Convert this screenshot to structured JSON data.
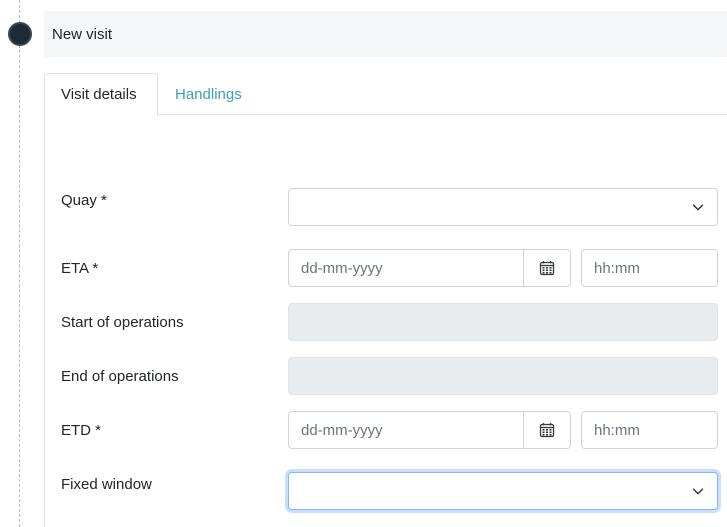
{
  "header": {
    "title": "New visit"
  },
  "tabs": [
    {
      "label": "Visit details",
      "active": true
    },
    {
      "label": "Handlings",
      "active": false
    }
  ],
  "form": {
    "quay": {
      "label": "Quay *",
      "value": ""
    },
    "eta": {
      "label": "ETA *",
      "date_placeholder": "dd-mm-yyyy",
      "time_placeholder": "hh:mm"
    },
    "start_ops": {
      "label": "Start of operations",
      "value": ""
    },
    "end_ops": {
      "label": "End of operations",
      "value": ""
    },
    "etd": {
      "label": "ETD *",
      "date_placeholder": "dd-mm-yyyy",
      "time_placeholder": "hh:mm"
    },
    "fixed_window": {
      "label": "Fixed window",
      "value": ""
    }
  },
  "icons": {
    "chevron": "chevron-down-icon",
    "calendar": "calendar-icon"
  },
  "colors": {
    "link": "#3aa0b8",
    "timeline_dot": "#1f2a37",
    "disabled_bg": "#e9ecef",
    "focus_border": "#86b7fe"
  }
}
